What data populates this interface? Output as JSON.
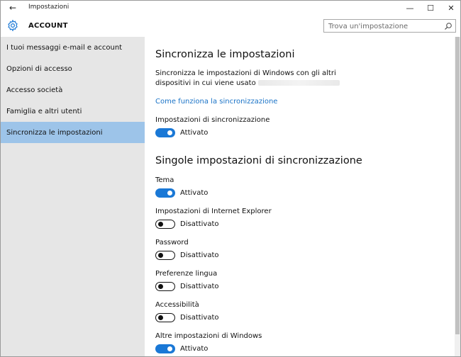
{
  "window": {
    "title": "Impostazioni",
    "back": "←",
    "minimize": "—",
    "maximize": "☐",
    "close": "✕"
  },
  "header": {
    "title": "ACCOUNT",
    "search_placeholder": "Trova un'impostazione"
  },
  "sidebar": {
    "items": [
      {
        "label": "I tuoi messaggi e-mail e account",
        "selected": false
      },
      {
        "label": "Opzioni di accesso",
        "selected": false
      },
      {
        "label": "Accesso società",
        "selected": false
      },
      {
        "label": "Famiglia e altri utenti",
        "selected": false
      },
      {
        "label": "Sincronizza le impostazioni",
        "selected": true
      }
    ]
  },
  "content": {
    "title": "Sincronizza le impostazioni",
    "description": "Sincronizza le impostazioni di Windows con gli altri dispositivi in cui viene usato",
    "link": "Come funziona la sincronizzazione",
    "sync_settings_label": "Impostazioni di sincronizzazione",
    "sync_settings_state": "Attivato",
    "individual_title": "Singole impostazioni di sincronizzazione",
    "settings": [
      {
        "label": "Tema",
        "state": "Attivato",
        "on": true
      },
      {
        "label": "Impostazioni di Internet Explorer",
        "state": "Disattivato",
        "on": false
      },
      {
        "label": "Password",
        "state": "Disattivato",
        "on": false
      },
      {
        "label": "Preferenze lingua",
        "state": "Disattivato",
        "on": false
      },
      {
        "label": "Accessibilità",
        "state": "Disattivato",
        "on": false
      },
      {
        "label": "Altre impostazioni di Windows",
        "state": "Attivato",
        "on": true
      }
    ]
  },
  "colors": {
    "accent": "#1a78d6",
    "link": "#1a73c7",
    "sidebar_bg": "#e6e6e6",
    "sidebar_selected": "#9dc4e9"
  }
}
